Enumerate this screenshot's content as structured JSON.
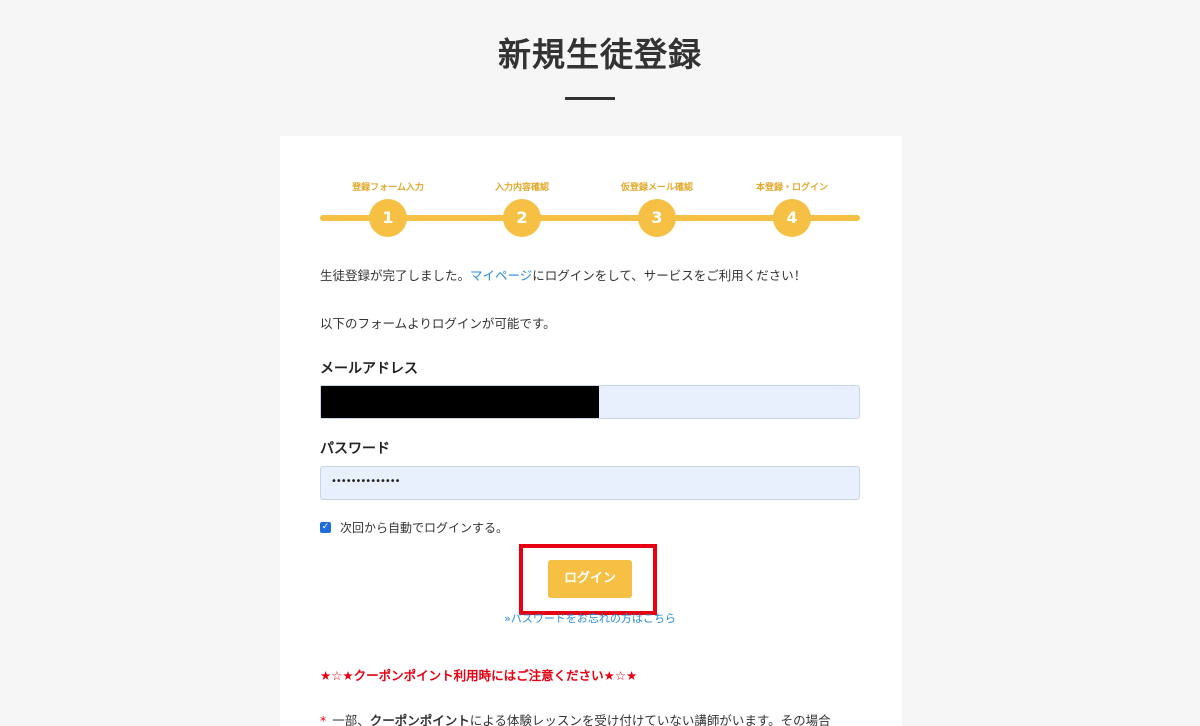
{
  "page": {
    "title": "新規生徒登録"
  },
  "steps": [
    {
      "label": "登録フォーム入力",
      "number": "1"
    },
    {
      "label": "入力内容確認",
      "number": "2"
    },
    {
      "label": "仮登録メール確認",
      "number": "3"
    },
    {
      "label": "本登録・ログイン",
      "number": "4"
    }
  ],
  "message": {
    "line1_before": "生徒登録が完了しました。",
    "line1_link": "マイページ",
    "line1_after": "にログインをして、サービスをご利用ください！",
    "line2": "以下のフォームよりログインが可能です。"
  },
  "form": {
    "email_label": "メールアドレス",
    "password_label": "パスワード",
    "password_value": "••••••••••••••",
    "remember_label": "次回から自動でログインする。",
    "remember_checked": true,
    "login_button": "ログイン",
    "forgot_link": "»パスワードをお忘れの方はこちら"
  },
  "notice": {
    "heading": "★☆★クーポンポイント利用時にはご注意ください★☆★",
    "asterisk": "*",
    "line_before": "一部、",
    "line_bold": "クーポンポイント",
    "line_after": "による体験レッスンを受け付けていない講師がいます。その場合"
  },
  "colors": {
    "accent": "#f5c043",
    "link": "#2a8ad8",
    "warning": "#e60012",
    "input_bg": "#e8f0fe"
  }
}
